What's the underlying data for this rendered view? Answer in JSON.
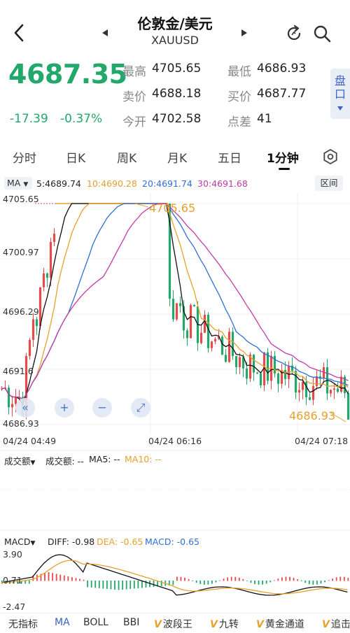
{
  "header": {
    "title": "伦敦金/美元",
    "symbol": "XAUUSD"
  },
  "quote": {
    "price": "4687.35",
    "change": "-17.39",
    "change_pct": "-0.37%",
    "high_label": "最高",
    "high": "4705.65",
    "low_label": "最低",
    "low": "4686.93",
    "sell_label": "卖价",
    "sell": "4688.18",
    "buy_label": "买价",
    "buy": "4687.77",
    "open_label": "今开",
    "open": "4702.58",
    "spread_label": "点差",
    "spread": "41",
    "pankou_label": "盘口"
  },
  "tabs": [
    {
      "label": "分时"
    },
    {
      "label": "日K"
    },
    {
      "label": "周K"
    },
    {
      "label": "月K"
    },
    {
      "label": "五日"
    },
    {
      "label": "1分钟"
    }
  ],
  "ma_legend": {
    "selector": "MA",
    "ma5": "5:4689.74",
    "ma10": "10:4690.28",
    "ma20": "20:4691.74",
    "ma30": "30:4691.68",
    "range_button": "区间"
  },
  "colors": {
    "up": "#e84a4a",
    "down": "#22a86b",
    "ma5": "#111111",
    "ma10": "#e8a02c",
    "ma20": "#2f6fd6",
    "ma30": "#c23aa8",
    "accent": "#3b63c6"
  },
  "icons": [
    "chevron-left-icon",
    "caret-left-icon",
    "caret-right-icon",
    "refresh-icon",
    "search-icon",
    "settings-icon",
    "double-left-icon",
    "zoom-in-icon",
    "zoom-out-icon",
    "expand-icon"
  ],
  "chart_data": {
    "type": "candlestick",
    "y_ticks": [
      "4705.65",
      "4700.97",
      "4696.29",
      "4691.6",
      "4686.93"
    ],
    "ylim": [
      4686.93,
      4705.65
    ],
    "x_ticks": [
      "04/24 04:49",
      "04/24 06:16",
      "04/24 07:18"
    ],
    "annotations": {
      "max": "4705.65",
      "min": "4686.93"
    },
    "controls": [
      "«",
      "+",
      "−",
      "⤢"
    ]
  },
  "volume": {
    "title": "成交额",
    "label": "成交额: --",
    "ma5": "MA5: --",
    "ma10": "MA10: --"
  },
  "macd": {
    "title": "MACD",
    "diff": "DIFF: -0.98",
    "dea": "DEA: -0.65",
    "macd": "MACD: -0.65",
    "y_ticks": [
      "3.90",
      "0.71",
      "-2.47"
    ]
  },
  "indicators": [
    {
      "label": "无指标"
    },
    {
      "label": "MA"
    },
    {
      "label": "BOLL"
    },
    {
      "label": "BBI"
    },
    {
      "label": "波段王"
    },
    {
      "label": "九转"
    },
    {
      "label": "黄金通道"
    },
    {
      "label": "追击"
    }
  ]
}
